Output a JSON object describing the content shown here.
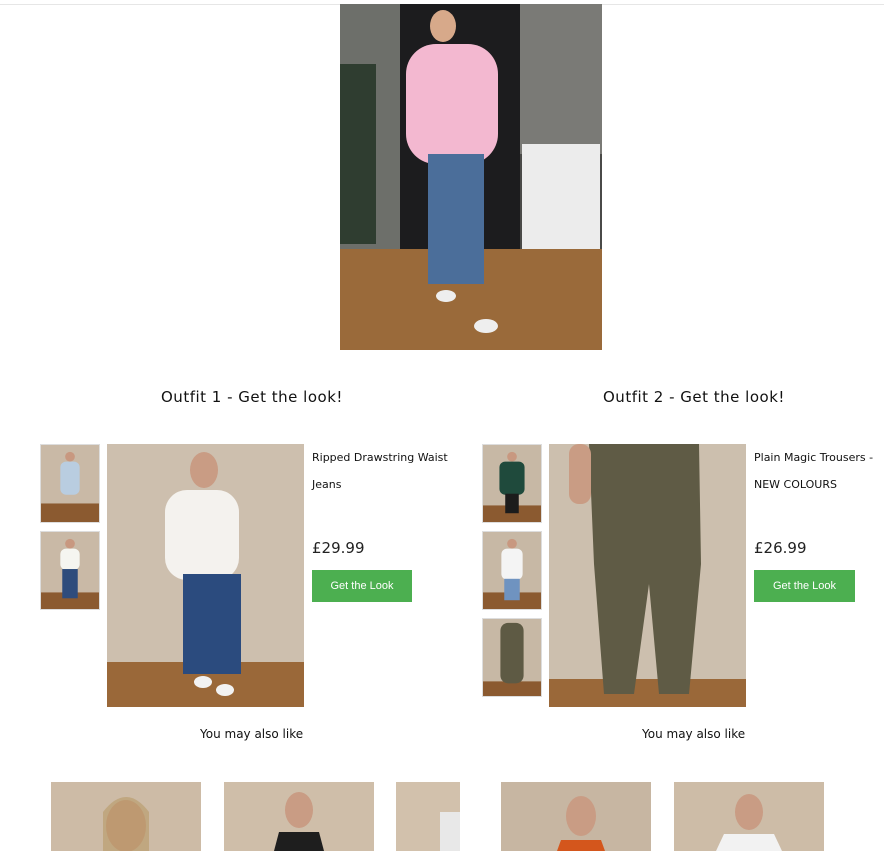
{
  "outfits": [
    {
      "heading": "Outfit 1 - Get the look!",
      "product_name_line1": "Ripped Drawstring Waist",
      "product_name_line2": "Jeans",
      "price": "£29.99",
      "button_label": "Get the Look",
      "also_like": "You may also like"
    },
    {
      "heading": "Outfit 2 - Get the look!",
      "product_name_line1": "Plain Magic Trousers -",
      "product_name_line2": "NEW COLOURS",
      "price": "£26.99",
      "button_label": "Get the Look",
      "also_like": "You may also like"
    }
  ],
  "colors": {
    "button": "#4caf50",
    "text": "#111111"
  }
}
